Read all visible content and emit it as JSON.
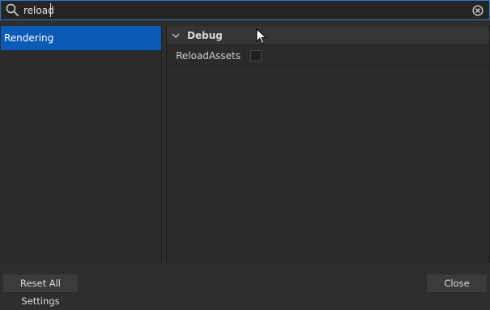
{
  "search": {
    "value": "reload",
    "icon": "search-icon",
    "clear_icon": "clear-circle-x-icon"
  },
  "categories": {
    "items": [
      {
        "label": "Rendering",
        "selected": true
      }
    ]
  },
  "settings": {
    "sections": [
      {
        "title": "Debug",
        "expanded": true,
        "rows": [
          {
            "label": "ReloadAssets",
            "checked": false
          }
        ]
      }
    ]
  },
  "footer": {
    "reset_label": "Reset All Settings",
    "close_label": "Close"
  },
  "colors": {
    "accent": "#3577c9",
    "selection": "#0b5ab6",
    "background": "#2e2e2e"
  }
}
